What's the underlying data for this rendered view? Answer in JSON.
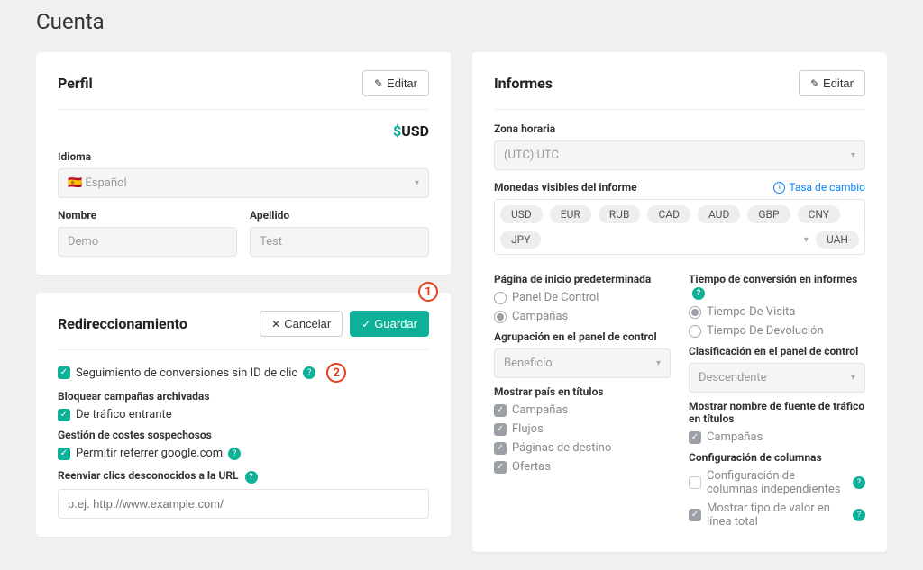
{
  "page_title": "Cuenta",
  "profile": {
    "card_title": "Perfil",
    "edit_label": "Editar",
    "currency_symbol": "$",
    "currency_code": "USD",
    "language_label": "Idioma",
    "language_value": "🇪🇸 Español",
    "first_name_label": "Nombre",
    "first_name_value": "Demo",
    "last_name_label": "Apellido",
    "last_name_value": "Test"
  },
  "redirect": {
    "card_title": "Redireccionamiento",
    "cancel_label": "Cancelar",
    "save_label": "Guardar",
    "tracking_label": "Seguimiento de conversiones sin ID de clic",
    "block_archived_label": "Bloquear campañas archivadas",
    "incoming_traffic_label": "De tráfico entrante",
    "suspicious_cost_label": "Gestión de costes sospechosos",
    "allow_referrer_label": "Permitir referrer google.com",
    "forward_clicks_label": "Reenviar clics desconocidos a la URL",
    "forward_clicks_placeholder": "p.ej. http://www.example.com/"
  },
  "annotations": {
    "one": "1",
    "two": "2"
  },
  "reports": {
    "card_title": "Informes",
    "edit_label": "Editar",
    "timezone_label": "Zona horaria",
    "timezone_value": "(UTC) UTC",
    "currencies_label": "Monedas visibles del informe",
    "exchange_rate": "Tasa de cambio",
    "currencies": [
      "USD",
      "EUR",
      "RUB",
      "CAD",
      "AUD",
      "GBP",
      "CNY",
      "JPY",
      "UAH"
    ],
    "default_home_label": "Página de inicio predeterminada",
    "home_dashboard": "Panel De Control",
    "home_campaigns": "Campañas",
    "conversion_time_label": "Tiempo de conversión en informes",
    "visit_time": "Tiempo De Visita",
    "return_time": "Tiempo De Devolución",
    "dashboard_group_label": "Agrupación en el panel de control",
    "dashboard_group_value": "Beneficio",
    "dashboard_sort_label": "Clasificación en el panel de control",
    "dashboard_sort_value": "Descendente",
    "show_country_label": "Mostrar país en títulos",
    "show_country_items": [
      "Campañas",
      "Flujos",
      "Páginas de destino",
      "Ofertas"
    ],
    "show_source_label": "Mostrar nombre de fuente de tráfico en títulos",
    "show_source_item": "Campañas",
    "columns_label": "Configuración de columnas",
    "independent_columns": "Configuración de columnas independientes",
    "show_value_type": "Mostrar tipo de valor en línea total"
  }
}
